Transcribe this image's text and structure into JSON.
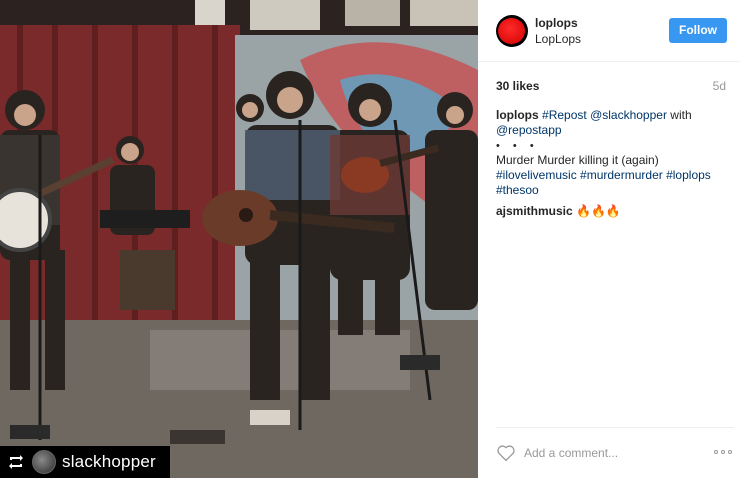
{
  "photo": {
    "repost_badge": {
      "icon": "repost-icon",
      "username": "slackhopper"
    }
  },
  "header": {
    "username": "loplops",
    "location": "LopLops",
    "follow_label": "Follow",
    "avatar_color": "#e00000",
    "follow_color": "#3897f0"
  },
  "stats": {
    "likes": "30 likes",
    "age": "5d"
  },
  "caption": {
    "author": "loplops",
    "repost_tag": "#Repost",
    "mention": "@slackhopper",
    "with_text": " with",
    "app_mention": "@repostapp",
    "dots": "• • •",
    "line": "Murder Murder killing it (again)",
    "tag1": "#ilovelivemusic",
    "tag2": "#murdermurder",
    "tag3": "#loplops",
    "tag4": "#thesoo"
  },
  "comment1": {
    "author": "ajsmithmusic",
    "text": "🔥🔥🔥"
  },
  "add_comment": {
    "placeholder": "Add a comment...",
    "heart_icon": "heart-outline-icon",
    "more_icon": "more-options-icon"
  }
}
